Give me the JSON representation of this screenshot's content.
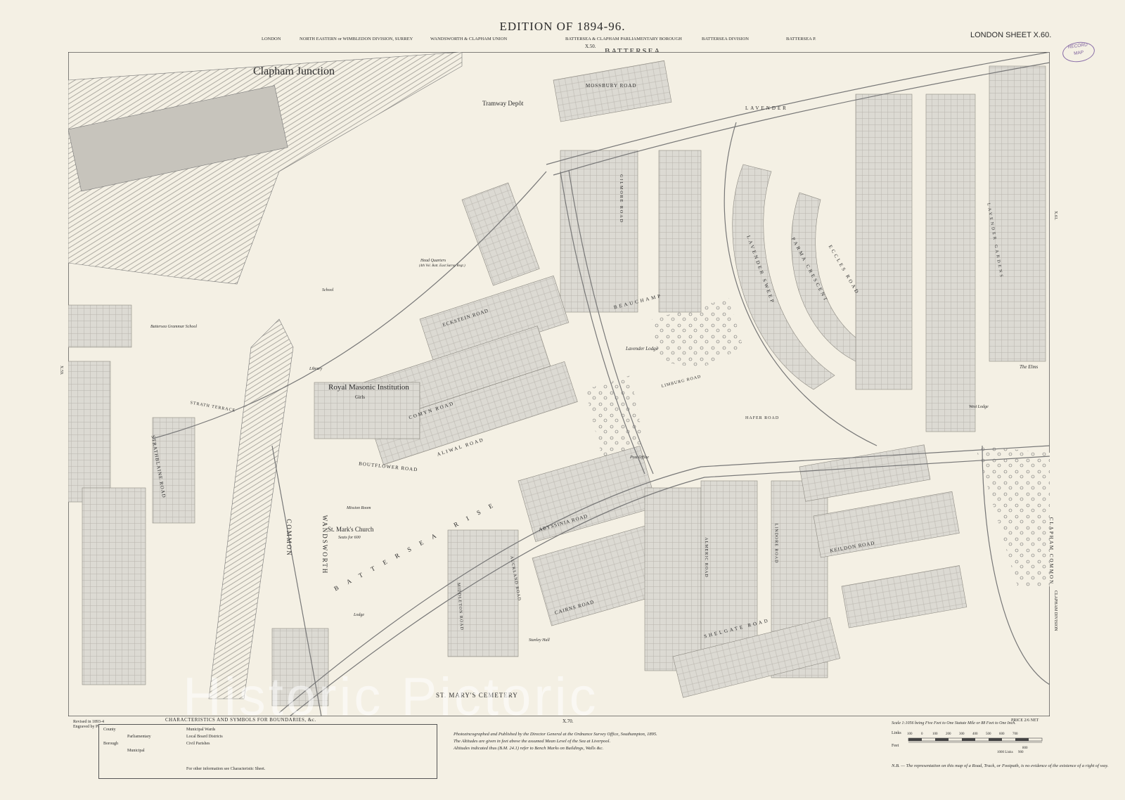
{
  "header": {
    "edition": "EDITION OF 1894-96.",
    "sheet": "LONDON   SHEET X.60.",
    "stamp_line1": "RECORD",
    "stamp_line2": "MAP",
    "borough": "BATTERSEA",
    "sheet_ref_top": "X.50.",
    "top_boundaries": [
      "LONDON",
      "NORTH EASTERN or WIMBLEDON DIVISION, SURREY",
      "WANDSWORTH & CLAPHAM UNION",
      "BATTERSEA & CLAPHAM PARLIAMENTARY BOROUGH",
      "BATTERSEA DIVISION",
      "BATTERSEA P."
    ]
  },
  "map_labels": {
    "clapham_junction": "Clapham Junction",
    "tramway_depot": "Tramway Depôt",
    "mossbury_road": "MOSSBURY ROAD",
    "lavender_road": "LAVENDER",
    "royal_masonic": "Royal Masonic Institution",
    "girls": "Girls",
    "head_quarters": "Head Quarters",
    "head_quarters_sub": "(4th Vol. Batt. East Surrey Regt.)",
    "school": "School",
    "library": "Library",
    "grammar_school": "Battersea Grammar School",
    "eckstein_road": "ECKSTEIN ROAD",
    "comyn_road": "COMYN ROAD",
    "aliwal_road": "ALIWAL ROAD",
    "boutflower_road": "BOUTFLOWER ROAD",
    "beauchamp": "BEAUCHAMP",
    "lavender_lodge": "Lavender Lodge",
    "lavender_sweep": "LAVENDER SWEEP",
    "eccles_road": "ECCLES ROAD",
    "parma_crescent": "PARMA CRESCENT",
    "limburg_road": "LIMBURG ROAD",
    "wandsworth_common": "WANDSWORTH",
    "common": "COMMON",
    "st_marks": "St. Mark's Church",
    "st_marks_sub": "Seats for 600",
    "mission_room": "Mission Room",
    "battersea_rise": "BATTERSEA RISE",
    "abyssinia_road": "ABYSSINIA ROAD",
    "auckland_road": "AUCKLAND ROAD",
    "cairns_road": "CAIRNS ROAD",
    "middleton_road": "MIDDLETON ROAD",
    "almeric_road": "ALMERIC ROAD",
    "lindore_road": "LINDORE ROAD",
    "keildon_road": "KEILDON ROAD",
    "shelgate_road": "SHELGATE ROAD",
    "stanley_hall": "Stanley Hall",
    "lodge": "Lodge",
    "st_marys_cemetery": "ST. MARY'S CEMETERY",
    "strathblaine_road": "STRATHBLAINE ROAD",
    "strath_terrace": "STRATH TERRACE",
    "the_elms": "The Elms",
    "west_lodge": "West Lodge",
    "clapham_common": "CLAPHAM COMMON",
    "lavender_gardens": "LAVENDER GARDENS",
    "post_office": "Post Office",
    "hafer_road": "HAFER ROAD",
    "gilmore_road": "GILMORE ROAD",
    "x59": "X.59.",
    "x61": "X.61.",
    "x70": "X.70.",
    "clapham_division": "CLAPHAM DIVISION",
    "watermark": "Historic Pictoric"
  },
  "legend": {
    "title": "CHARACTERISTICS AND SYMBOLS FOR BOUNDARIES, &c.",
    "revised": "Revised in 1893-4",
    "engraved": "Engraved by Photozincography",
    "rows": [
      "County",
      "Borough",
      "Parliamentary",
      "Municipal",
      "Municipal Wards",
      "Local Board Districts",
      "Civil Parishes"
    ],
    "other_info": "For other information see Characteristic Sheet."
  },
  "notes": {
    "line1": "Photozincographed and Published by the Director General at the Ordnance Survey Office, Southampton, 1895.",
    "line2": "The Altitudes are given in feet above the assumed Mean Level of the Sea at Liverpool.",
    "line3": "Altitudes indicated thus (B.M. 24.1) refer to Bench Marks on Buildings, Walls &c."
  },
  "scale": {
    "title": "Scale 1:1056 being Five Feet to One Statute Mile or 88 Feet to One Inch.",
    "price": "PRICE 2/6 NET",
    "links": "Links",
    "feet": "Feet",
    "ticks": [
      "100",
      "0",
      "100",
      "200",
      "300",
      "400",
      "500",
      "600",
      "700",
      "800",
      "900",
      "1000 Links"
    ]
  },
  "nb": "N.B. — The representation on this map of a Road, Track, or Footpath, is no evidence of the existence of a right of way."
}
